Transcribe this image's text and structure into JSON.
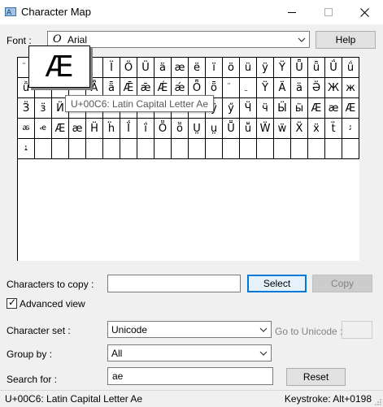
{
  "window": {
    "title": "Character Map"
  },
  "font": {
    "label": "Font :",
    "selected": "Arial",
    "font_icon_glyph": "O",
    "help_button": "Help"
  },
  "grid": {
    "cells": [
      "",
      "",
      "",
      "",
      "",
      "",
      "",
      "",
      "",
      "",
      "",
      "",
      "",
      "",
      "",
      "",
      "",
      "",
      "",
      "",
      "",
      "",
      "",
      "",
      "",
      "",
      "",
      "",
      "",
      "",
      "",
      "",
      "",
      "",
      "",
      "",
      "",
      "",
      "",
      "",
      "",
      "",
      "",
      "",
      "",
      "",
      "",
      "",
      "",
      "",
      "",
      "",
      "",
      "",
      "",
      "",
      "",
      "",
      "",
      "",
      "",
      "",
      "",
      "",
      "",
      "",
      "",
      "",
      "",
      "",
      "",
      "",
      "",
      "",
      "",
      "",
      "",
      "",
      "",
      "",
      "",
      "",
      "",
      "",
      "",
      "",
      "",
      "",
      "",
      "",
      "",
      "",
      "",
      "",
      "",
      "",
      "",
      "",
      "",
      "",
      "",
      "",
      "",
      "",
      "",
      "",
      "",
      "",
      "",
      "",
      "",
      "",
      "",
      "",
      "",
      "",
      "",
      "",
      "",
      "",
      "",
      "",
      "",
      "",
      "",
      "",
      "",
      "",
      "",
      "",
      "",
      "",
      "",
      "",
      "",
      "",
      "",
      "",
      "",
      "",
      "",
      "",
      "",
      "",
      "",
      "",
      "",
      "",
      "",
      "",
      "",
      "",
      "",
      "",
      "",
      "",
      "",
      "",
      "",
      "",
      "",
      "",
      "",
      "",
      "",
      "",
      "",
      "",
      "",
      "",
      "",
      "",
      "",
      "",
      "",
      "",
      "",
      "",
      "",
      "",
      "",
      "",
      "",
      "",
      "",
      "",
      "",
      "",
      "",
      "",
      "",
      "",
      "",
      "",
      "",
      "",
      "",
      "",
      "",
      ""
    ],
    "visible": [
      "̈",
      "",
      "",
      "",
      "",
      "Ï",
      "Ö",
      "Ü",
      "ä",
      "æ",
      "ë",
      "ï",
      "ö",
      "ü",
      "ÿ",
      "Ÿ",
      "Ǖ",
      "ǖ",
      "Ǘ",
      "ǘ",
      "ǚ",
      "",
      "",
      "",
      "Ǟ",
      "ǟ",
      "Ǣ",
      "ǣ",
      "Ǽ",
      "ǽ",
      "Ȫ",
      "ȫ",
      "̈",
      "̤",
      "Ÿ",
      "Ӓ",
      "ӓ",
      "Ӛ",
      "Ж",
      "ж",
      "Ӟ",
      "ӟ",
      "Ӥ",
      "ӥ",
      "Ӧ",
      "ӧ",
      "Ӫ",
      "ӫ",
      "Ӭ",
      "ӭ",
      "Ӱ",
      "ӱ",
      "ӳ",
      "Ӵ",
      "ӵ",
      "Ӹ",
      "ӹ",
      "Ӕ",
      "ӕ",
      "Ӕ",
      "ꬱ",
      "ꬴ",
      "Ӕ",
      "ӕ",
      "Ḧ",
      "ḧ",
      "Ḯ",
      "ḯ",
      "Ṏ",
      "ṏ",
      "Ṳ",
      "ṳ",
      "Ṻ",
      "ṻ",
      "Ẅ",
      "ẅ",
      "Ẍ",
      "ẍ",
      "ẗ",
      "ﺋ",
      "ﺌ",
      "",
      "",
      "",
      "",
      "",
      "",
      "",
      "",
      "",
      "",
      "",
      "",
      "",
      "",
      "",
      "",
      "",
      "",
      ""
    ],
    "zoom_char": "Æ",
    "tooltip": "U+00C6: Latin Capital Letter Ae"
  },
  "copy": {
    "label": "Characters to copy :",
    "value": "",
    "select_button": "Select",
    "copy_button": "Copy"
  },
  "advanced": {
    "label": "Advanced view",
    "checked": true,
    "check_glyph": "✓"
  },
  "charset": {
    "label": "Character set :",
    "selected": "Unicode",
    "goto_label": "Go to Unicode :",
    "goto_value": ""
  },
  "groupby": {
    "label": "Group by :",
    "selected": "All"
  },
  "search": {
    "label": "Search for :",
    "value": "ae",
    "reset_button": "Reset"
  },
  "status": {
    "left": "U+00C6: Latin Capital Letter Ae",
    "right": "Keystroke: Alt+0198"
  }
}
